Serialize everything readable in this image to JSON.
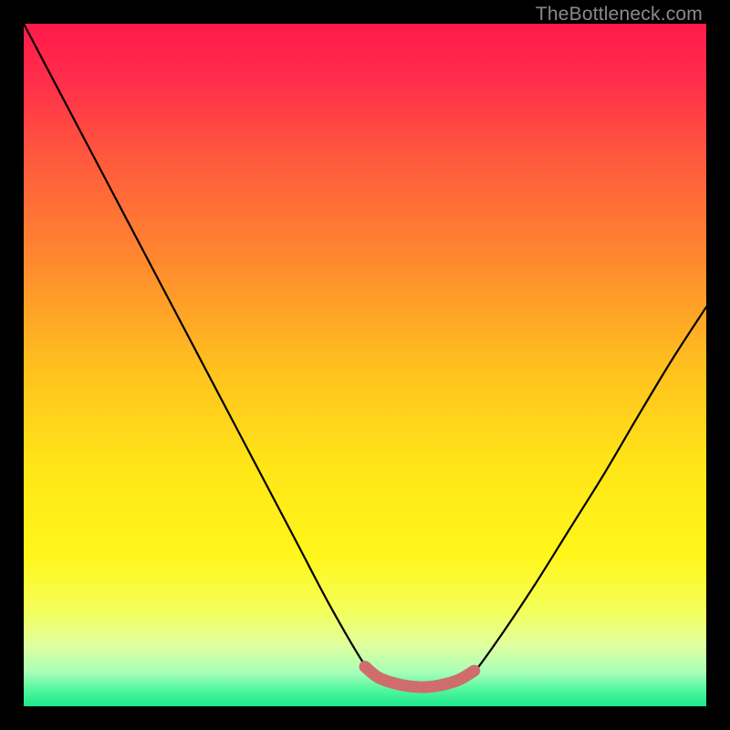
{
  "watermark": "TheBottleneck.com",
  "chart_data": {
    "type": "line",
    "title": "",
    "xlabel": "",
    "ylabel": "",
    "xlim": [
      0,
      100
    ],
    "ylim": [
      0,
      100
    ],
    "grid": false,
    "legend": false,
    "series": [
      {
        "name": "bottleneck-curve",
        "x": [
          0,
          5,
          10,
          15,
          20,
          25,
          30,
          35,
          40,
          45,
          50,
          52,
          55,
          58,
          60,
          62,
          64,
          66,
          70,
          75,
          80,
          85,
          90,
          95,
          100
        ],
        "y": [
          100,
          90.5,
          81,
          71.5,
          62,
          52.5,
          43,
          33.5,
          24,
          14.5,
          6,
          4,
          2.8,
          2.5,
          2.6,
          3,
          3.7,
          5,
          10.5,
          18,
          26,
          34,
          42.5,
          50.8,
          58.5
        ]
      },
      {
        "name": "optimal-band",
        "x": [
          50,
          52,
          55,
          58,
          60,
          62,
          64,
          66
        ],
        "y": [
          5.8,
          4.2,
          3.2,
          2.8,
          2.9,
          3.3,
          4,
          5.2
        ]
      }
    ],
    "gradient_stops": [
      {
        "offset": 0.0,
        "color": "#ff1a4a"
      },
      {
        "offset": 0.08,
        "color": "#ff2d4a"
      },
      {
        "offset": 0.2,
        "color": "#ff5a3d"
      },
      {
        "offset": 0.35,
        "color": "#ff8a2e"
      },
      {
        "offset": 0.5,
        "color": "#ffbf1f"
      },
      {
        "offset": 0.65,
        "color": "#ffe617"
      },
      {
        "offset": 0.78,
        "color": "#fff61a"
      },
      {
        "offset": 0.86,
        "color": "#f4ff5a"
      },
      {
        "offset": 0.91,
        "color": "#e0ff9e"
      },
      {
        "offset": 0.95,
        "color": "#a8ffb8"
      },
      {
        "offset": 0.975,
        "color": "#55f7a0"
      },
      {
        "offset": 1.0,
        "color": "#19e88a"
      }
    ],
    "curve_color": "#000000",
    "band_color": "#cf6d6d"
  }
}
